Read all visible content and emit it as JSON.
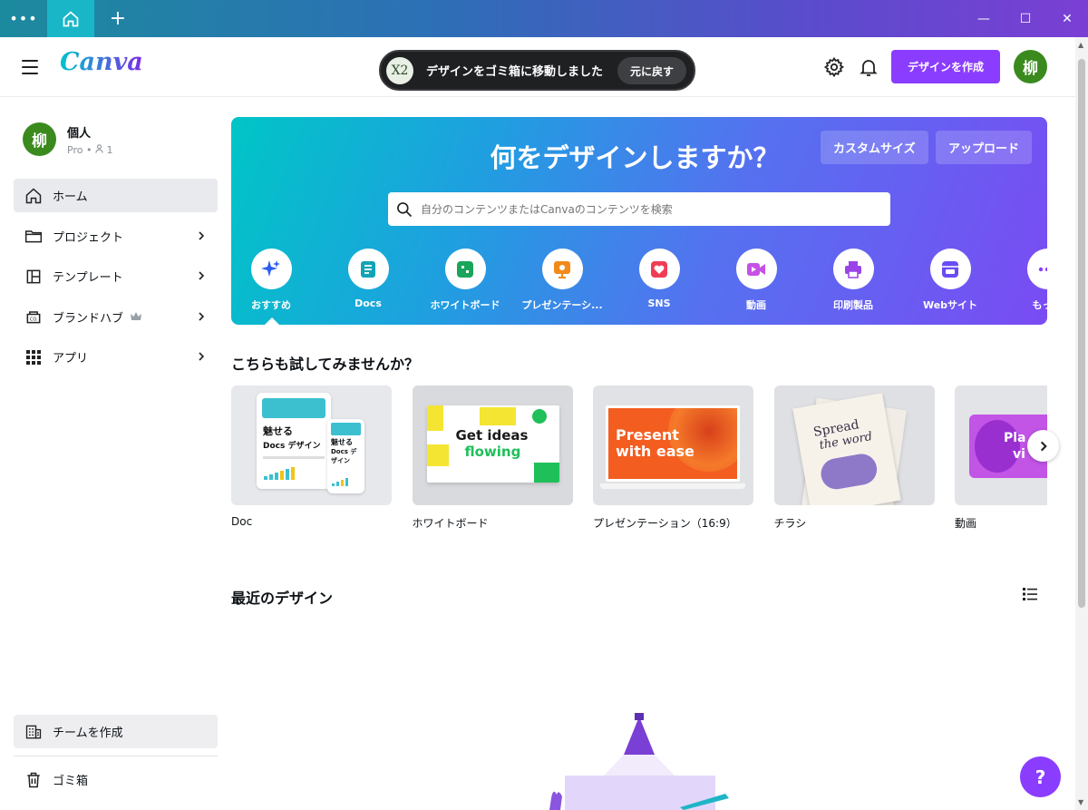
{
  "titlebar": {
    "dots": "•••",
    "new_tab": "+",
    "minimize": "—",
    "maximize": "☐",
    "close": "✕"
  },
  "header": {
    "logo": "Canva",
    "toast": {
      "badge": "X2",
      "message": "デザインをゴミ箱に移動しました",
      "undo": "元に戻す"
    },
    "create_button": "デザインを作成",
    "avatar": "柳"
  },
  "sidebar": {
    "profile": {
      "avatar": "柳",
      "name": "個人",
      "plan": "Pro • ",
      "members": "1"
    },
    "items": [
      {
        "label": "ホーム",
        "icon": "home-icon",
        "chevron": false
      },
      {
        "label": "プロジェクト",
        "icon": "folder-icon",
        "chevron": true
      },
      {
        "label": "テンプレート",
        "icon": "template-icon",
        "chevron": true
      },
      {
        "label": "ブランドハブ",
        "icon": "brand-icon",
        "chevron": true
      },
      {
        "label": "アプリ",
        "icon": "apps-grid-icon",
        "chevron": true
      }
    ],
    "team_button": "チームを作成",
    "trash": "ゴミ箱"
  },
  "hero": {
    "title": "何をデザインしますか？",
    "custom_size": "カスタムサイズ",
    "upload": "アップロード",
    "search_placeholder": "自分のコンテンツまたはCanvaのコンテンツを検索",
    "categories": [
      {
        "label": "おすすめ",
        "icon": "sparkle-icon",
        "color": "#2b5cf0"
      },
      {
        "label": "Docs",
        "icon": "docs-icon",
        "color": "#13a3b5"
      },
      {
        "label": "ホワイトボード",
        "icon": "whiteboard-icon",
        "color": "#1aa55a"
      },
      {
        "label": "プレゼンテーシ...",
        "icon": "presentation-icon",
        "color": "#f28a1b"
      },
      {
        "label": "SNS",
        "icon": "heart-icon",
        "color": "#ef3d54"
      },
      {
        "label": "動画",
        "icon": "video-icon",
        "color": "#c650e6"
      },
      {
        "label": "印刷製品",
        "icon": "printer-icon",
        "color": "#9a43e8"
      },
      {
        "label": "Webサイト",
        "icon": "website-icon",
        "color": "#6a4cf5"
      },
      {
        "label": "もっと",
        "icon": "more-icon",
        "color": "#8b3dff"
      }
    ]
  },
  "try_section": {
    "title": "こちらも試してみませんか？",
    "cards": [
      {
        "label": "Doc",
        "thumb_title": "魅せる",
        "thumb_sub": "Docs デザイン",
        "mini_title": "魅せる",
        "mini_sub": "Docs デザイン"
      },
      {
        "label": "ホワイトボード",
        "thumb_text": "Get ideas",
        "thumb_text2": "flowing"
      },
      {
        "label": "プレゼンテーション（16:9）",
        "thumb_text": "Present",
        "thumb_text2": "with ease"
      },
      {
        "label": "チラシ",
        "thumb_text": "Spread",
        "thumb_text2": "the word"
      },
      {
        "label": "動画",
        "thumb_text": "Pla",
        "thumb_text2": "vi"
      }
    ]
  },
  "recent": {
    "title": "最近のデザイン"
  },
  "help": "?"
}
